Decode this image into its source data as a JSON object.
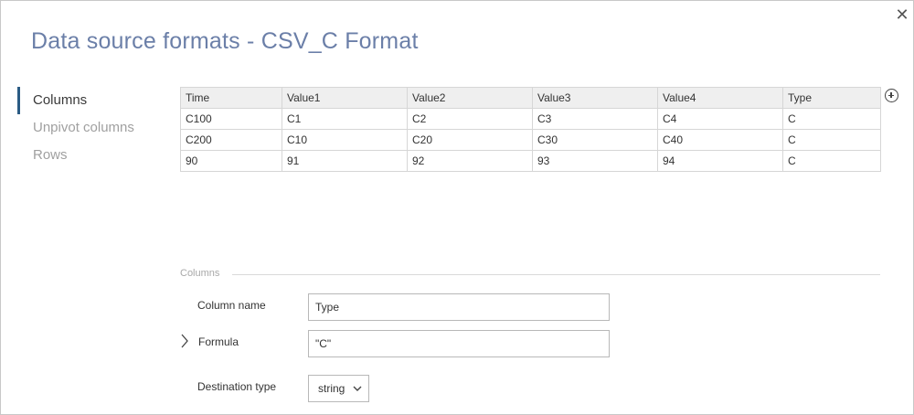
{
  "dialog": {
    "title": "Data source formats - CSV_C Format",
    "close_label": "✕"
  },
  "nav": {
    "items": [
      {
        "label": "Columns",
        "active": true
      },
      {
        "label": "Unpivot columns",
        "active": false
      },
      {
        "label": "Rows",
        "active": false
      }
    ]
  },
  "table": {
    "headers": [
      "Time",
      "Value1",
      "Value2",
      "Value3",
      "Value4",
      "Type"
    ],
    "rows": [
      [
        "C100",
        "C1",
        "C2",
        "C3",
        "C4",
        "C"
      ],
      [
        "C200",
        "C10",
        "C20",
        "C30",
        "C40",
        "C"
      ],
      [
        "90",
        "91",
        "92",
        "93",
        "94",
        "C"
      ]
    ],
    "add_column_icon": "plus-circle-icon"
  },
  "columns_section": {
    "header": "Columns",
    "column_name_label": "Column name",
    "column_name_value": "Type",
    "formula_label": "Formula",
    "formula_value": "\"C\"",
    "destination_type_label": "Destination type",
    "destination_type_value": "string"
  },
  "colors": {
    "title": "#6b7fa8",
    "nav_active_marker": "#2b5b84",
    "table_header_bg": "#efefef"
  }
}
